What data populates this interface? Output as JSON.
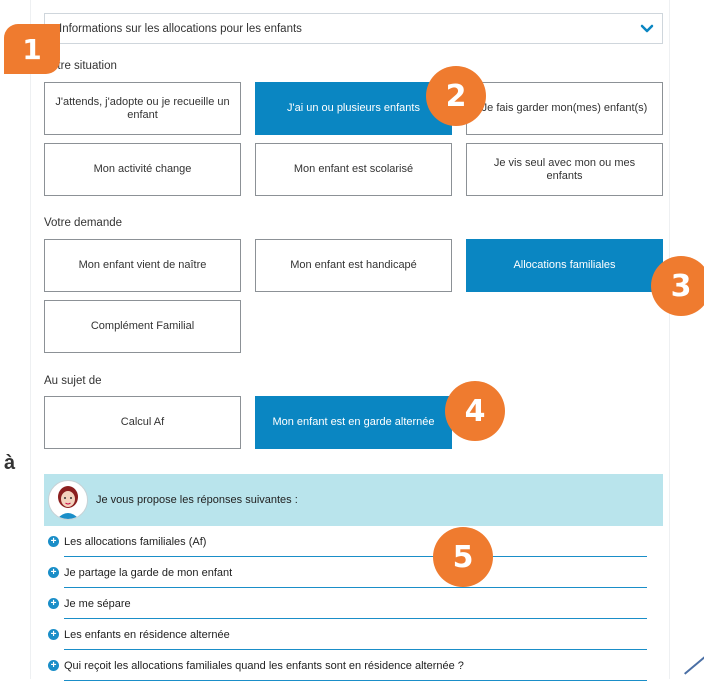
{
  "dropdown": {
    "label": "Informations sur les allocations pour les enfants",
    "chevron_icon": "chevron-down-icon"
  },
  "badges": [
    "1",
    "2",
    "3",
    "4",
    "5"
  ],
  "side_letter": "à",
  "situation": {
    "label": "Votre situation",
    "options": [
      {
        "label": "J'attends, j'adopte ou je recueille un enfant",
        "selected": false
      },
      {
        "label": "J'ai un ou plusieurs enfants",
        "selected": true
      },
      {
        "label": "Je fais garder mon(mes) enfant(s)",
        "selected": false
      },
      {
        "label": "Mon activité change",
        "selected": false
      },
      {
        "label": "Mon enfant est scolarisé",
        "selected": false
      },
      {
        "label": "Je vis seul avec mon ou mes enfants",
        "selected": false
      }
    ]
  },
  "demande": {
    "label": "Votre demande",
    "options": [
      {
        "label": "Mon enfant vient de naître",
        "selected": false
      },
      {
        "label": "Mon enfant est handicapé",
        "selected": false
      },
      {
        "label": "Allocations familiales",
        "selected": true
      },
      {
        "label": "Complément Familial",
        "selected": false
      }
    ]
  },
  "sujet": {
    "label": "Au sujet de",
    "options": [
      {
        "label": "Calcul Af",
        "selected": false
      },
      {
        "label": "Mon enfant est en garde alternée",
        "selected": true
      }
    ]
  },
  "answers": {
    "heading": "Je vous propose les réponses suivantes :",
    "items": [
      "Les allocations familiales (Af)",
      "Je partage la garde de mon enfant",
      "Je me sépare",
      "Les enfants en résidence alternée",
      "Qui reçoit les allocations familiales quand les enfants sont en résidence alternée ?"
    ]
  },
  "colors": {
    "accent": "#0a86c2",
    "badge": "#ef7b2f",
    "answer_header": "#b9e4ec"
  }
}
